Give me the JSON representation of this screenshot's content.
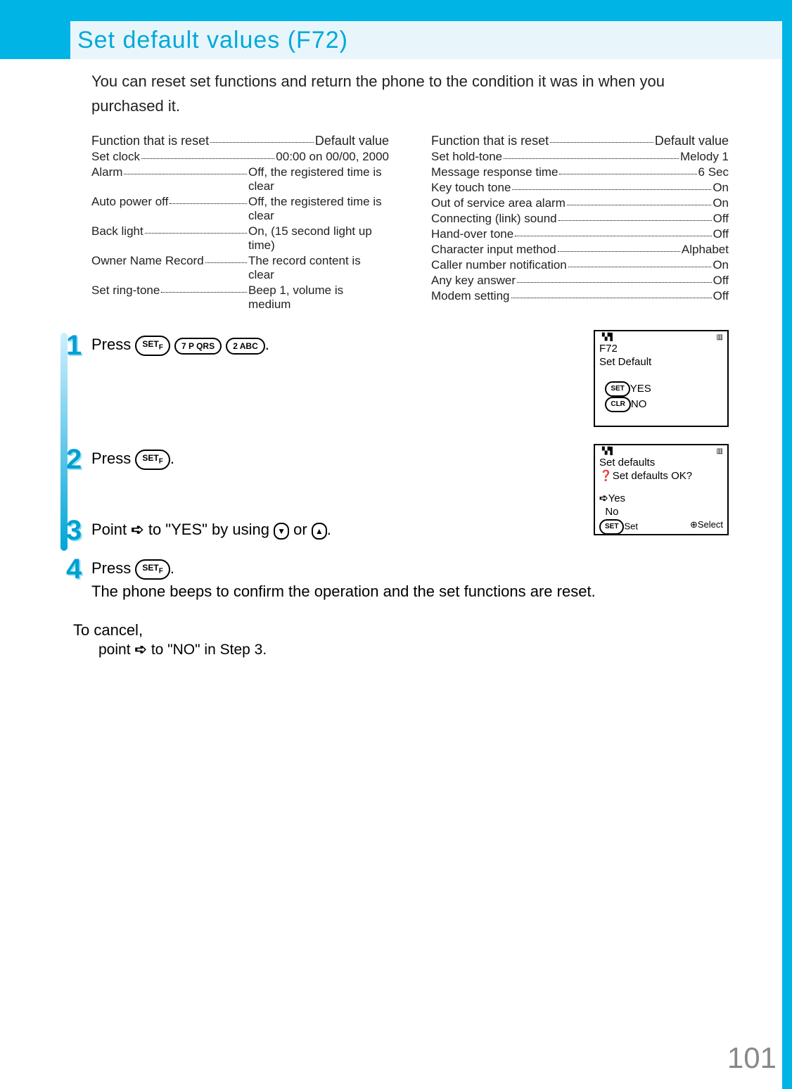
{
  "title": "Set default values (F72)",
  "intro": "You can reset set functions and return the phone to the condition it was in when you purchased it.",
  "tableHeaderLeft": "Function that is reset",
  "tableHeaderRight": "Default value",
  "left": [
    {
      "fn": "Set clock",
      "val": "00:00 on 00/00, 2000",
      "multiline": true
    },
    {
      "fn": "Alarm",
      "val": "Off, the registered time is clear",
      "multiline": true
    },
    {
      "fn": "Auto power off",
      "val": "Off, the registered time is clear",
      "multiline": true
    },
    {
      "fn": "Back light",
      "val": "On, (15 second light up time)",
      "multiline": true
    },
    {
      "fn": "Owner Name Record",
      "val": "The record content is clear",
      "multiline": true
    },
    {
      "fn": "Set ring-tone",
      "val": "Beep 1, volume is medium",
      "multiline": true
    }
  ],
  "right": [
    {
      "fn": "Set hold-tone",
      "val": "Melody 1"
    },
    {
      "fn": "Message response time",
      "val": "6 Sec"
    },
    {
      "fn": "Key touch tone",
      "val": "On"
    },
    {
      "fn": "Out of service area alarm",
      "val": "On"
    },
    {
      "fn": "Connecting (link) sound",
      "val": "Off"
    },
    {
      "fn": "Hand-over tone",
      "val": "Off"
    },
    {
      "fn": "Character input method",
      "val": "Alphabet"
    },
    {
      "fn": "Caller number notification",
      "val": "On"
    },
    {
      "fn": "Any key answer",
      "val": "Off"
    },
    {
      "fn": "Modem setting",
      "val": "Off"
    }
  ],
  "steps": {
    "s1_pre": "Press ",
    "btn_set": "SET",
    "btn_setF": "F",
    "btn7": "7 P QRS",
    "btn2": "2 ABC",
    "s2": "Press ",
    "s3_a": "Point ",
    "s3_b": " to \"YES\" by using ",
    "s3_c": " or ",
    "s4_a": "Press ",
    "s4_b": "The phone beeps to confirm the operation and the set functions are reset.",
    "cancel_title": "To cancel,",
    "cancel_body_a": "point ",
    "cancel_body_b": " to \"NO\" in Step 3."
  },
  "screen1": {
    "l1": "F72",
    "l2": "Set Default",
    "yes": "YES",
    "no": "NO",
    "yesIcon": "SET",
    "noIcon": "CLR"
  },
  "screen2": {
    "l1": "Set defaults",
    "l2": "Set defaults OK?",
    "yes": "Yes",
    "no": "No",
    "leftFoot": "Set",
    "rightFoot": "Select",
    "leftFootIcon": "SET"
  },
  "pagenum": "101"
}
